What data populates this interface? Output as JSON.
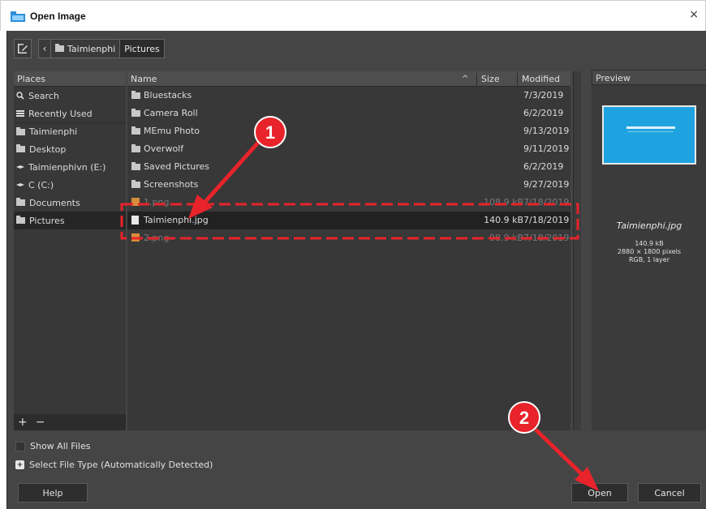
{
  "window": {
    "title": "Open Image",
    "close_glyph": "×"
  },
  "toolbar": {
    "edit_icon": "edit-location-icon",
    "back_icon": "chevron-left-icon",
    "breadcrumbs": [
      {
        "label": "Taimienphi",
        "icon": "folder-icon"
      },
      {
        "label": "Pictures"
      }
    ]
  },
  "places": {
    "header": "Places",
    "items": [
      {
        "label": "Search",
        "icon": "search-icon"
      },
      {
        "label": "Recently Used",
        "icon": "recent-icon"
      },
      {
        "label": "Taimienphi",
        "icon": "folder-icon"
      },
      {
        "label": "Desktop",
        "icon": "folder-icon"
      },
      {
        "label": "Taimienphivn (E:)",
        "icon": "drive-icon"
      },
      {
        "label": "C (C:)",
        "icon": "drive-icon"
      },
      {
        "label": "Documents",
        "icon": "folder-icon"
      },
      {
        "label": "Pictures",
        "icon": "folder-icon"
      }
    ],
    "add_glyph": "+",
    "remove_glyph": "−"
  },
  "files": {
    "columns": {
      "name": "Name",
      "size": "Size",
      "modified": "Modified"
    },
    "sort_glyph": "^",
    "rows": [
      {
        "name": "Bluestacks",
        "size": "",
        "modified": "7/3/2019",
        "icon": "folder-icon"
      },
      {
        "name": "Camera Roll",
        "size": "",
        "modified": "6/2/2019",
        "icon": "folder-icon"
      },
      {
        "name": "MEmu Photo",
        "size": "",
        "modified": "9/13/2019",
        "icon": "folder-icon"
      },
      {
        "name": "Overwolf",
        "size": "",
        "modified": "9/11/2019",
        "icon": "folder-icon"
      },
      {
        "name": "Saved Pictures",
        "size": "",
        "modified": "6/2/2019",
        "icon": "folder-icon"
      },
      {
        "name": "Screenshots",
        "size": "",
        "modified": "9/27/2019",
        "icon": "folder-icon"
      },
      {
        "name": "1.png",
        "size": "108.9 kB",
        "modified": "7/18/2019",
        "icon": "image-icon"
      },
      {
        "name": "Taimienphi.jpg",
        "size": "140.9 kB",
        "modified": "7/18/2019",
        "icon": "file-icon",
        "selected": true
      },
      {
        "name": "2.png",
        "size": "98.9 kB",
        "modified": "7/18/2019",
        "icon": "image-icon"
      }
    ]
  },
  "preview": {
    "header": "Preview",
    "file_name": "Taimienphi.jpg",
    "size": "140.9 kB",
    "dimensions": "2880 × 1800 pixels",
    "mode": "RGB, 1 layer"
  },
  "options": {
    "show_all_files": "Show All Files",
    "select_file_type": "Select File Type (Automatically Detected)"
  },
  "buttons": {
    "help": "Help",
    "open": "Open",
    "cancel": "Cancel"
  },
  "annotations": {
    "step1": "1",
    "step2": "2",
    "color": "#e8232a"
  }
}
